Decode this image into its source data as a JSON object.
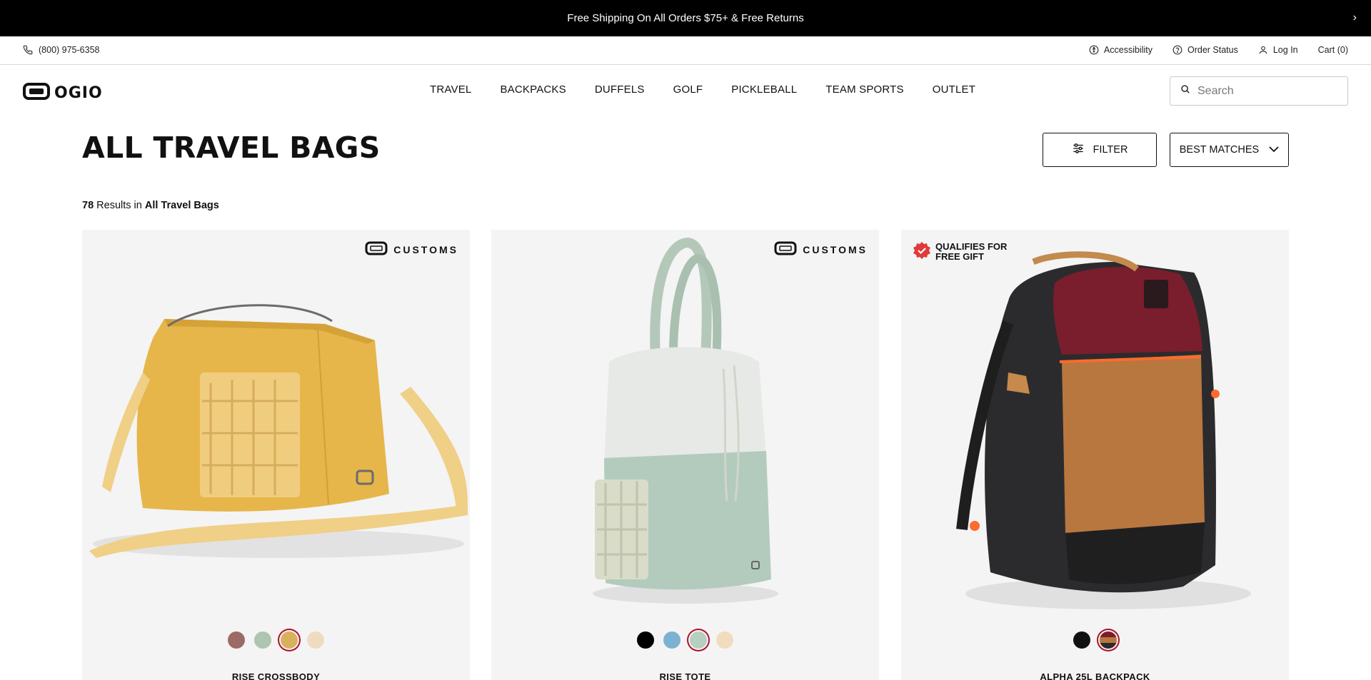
{
  "promo": {
    "text": "Free Shipping On All Orders $75+ & Free Returns",
    "arrow": "›"
  },
  "utility": {
    "phone": "(800) 975-6358",
    "links": [
      "Accessibility",
      "Order Status",
      "Log In",
      "Cart (0)"
    ]
  },
  "header": {
    "logo_text": "OGIO",
    "nav": [
      "TRAVEL",
      "BACKPACKS",
      "DUFFELS",
      "GOLF",
      "PICKLEBALL",
      "TEAM SPORTS",
      "OUTLET"
    ],
    "search_placeholder": "Search"
  },
  "page": {
    "title": "ALL TRAVEL BAGS",
    "filter_label": "FILTER",
    "sort_label": "BEST MATCHES",
    "results_count": "78",
    "results_text": " Results in ",
    "results_category": "All Travel Bags"
  },
  "products": [
    {
      "name": "RISE CROSSBODY",
      "badge": "CUSTOMS",
      "swatches": [
        "#9c6b66",
        "#aec5b0",
        "#d9b15e",
        "#efdcc0"
      ],
      "selected_swatch": 2
    },
    {
      "name": "RISE TOTE",
      "badge": "CUSTOMS",
      "swatches": [
        "#000000",
        "#7db1d1",
        "#b6cfc0",
        "#f2dcc0"
      ],
      "selected_swatch": 2
    },
    {
      "name": "ALPHA 25L BACKPACK",
      "badge": "QUALIFIES FOR FREE GIFT",
      "badge_line1": "QUALIFIES FOR",
      "badge_line2": "FREE GIFT",
      "swatches": [
        "#111111",
        "#6b4a35"
      ],
      "selected_swatch": 1
    }
  ],
  "colors": {
    "accent": "#b0102c",
    "badge_red": "#e03a3a"
  }
}
